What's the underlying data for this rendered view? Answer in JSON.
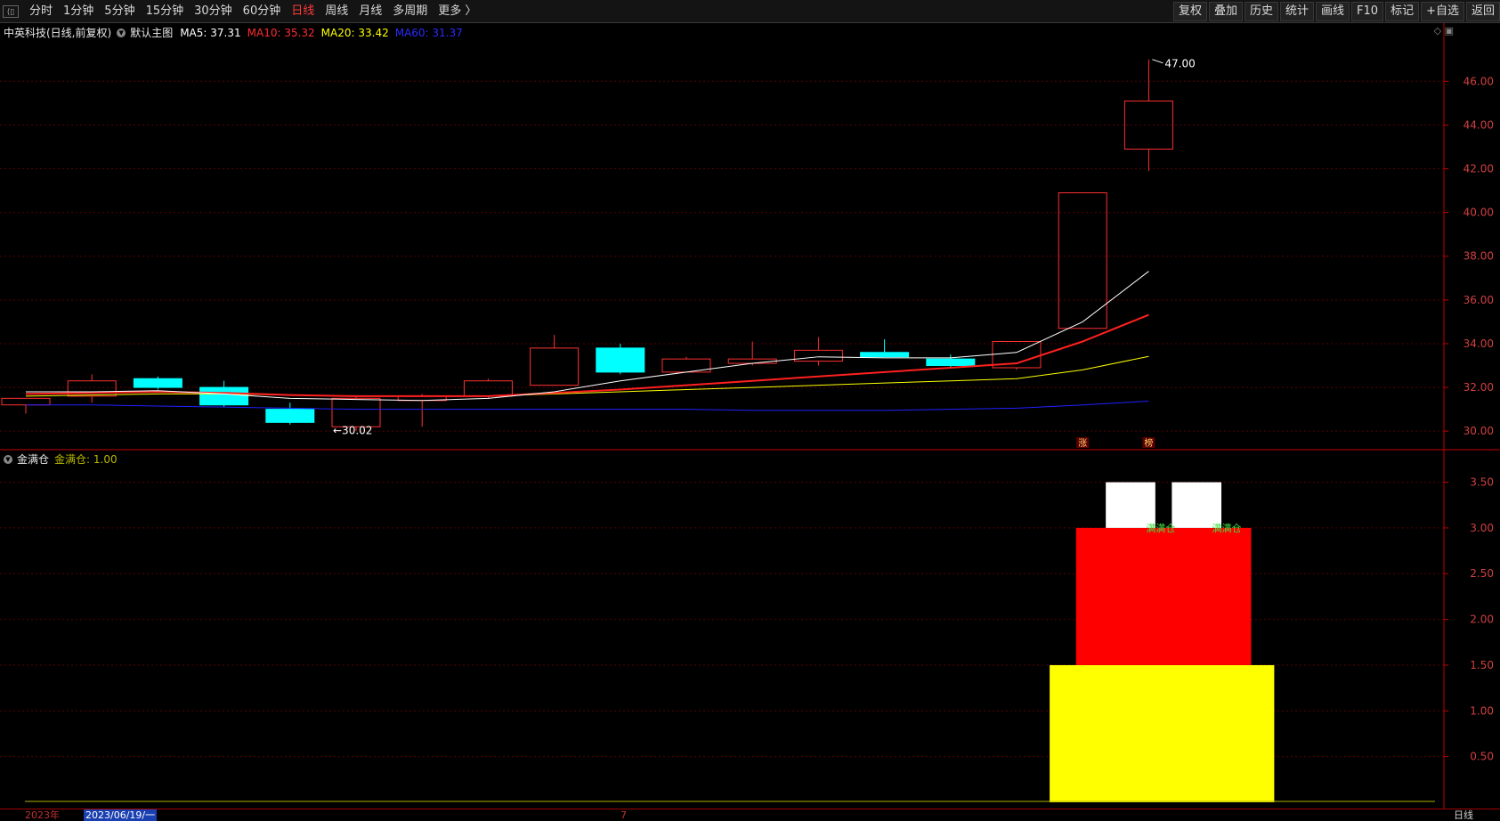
{
  "toolbar": {
    "back_icon": "back-arrow-icon",
    "periods": [
      "分时",
      "1分钟",
      "5分钟",
      "15分钟",
      "30分钟",
      "60分钟",
      "日线",
      "周线",
      "月线",
      "多周期",
      "更多 〉"
    ],
    "active_period": "日线",
    "tools": [
      "复权",
      "叠加",
      "历史",
      "统计",
      "画线",
      "F10",
      "标记",
      "+自选",
      "返回"
    ]
  },
  "main_panel": {
    "stock_title": "中英科技(日线,前复权)",
    "template_label": "默认主图",
    "ma": [
      {
        "label": "MA5: 37.31",
        "color": "#ffffff"
      },
      {
        "label": "MA10: 35.32",
        "color": "#ff2b2b"
      },
      {
        "label": "MA20: 33.42",
        "color": "#ffff00"
      },
      {
        "label": "MA60: 31.37",
        "color": "#2b2bff"
      }
    ],
    "high_marker": "47.00",
    "low_marker": "30.02",
    "badges": [
      "涨",
      "榜"
    ],
    "window_icons": "◇ ▣"
  },
  "sub_panel": {
    "indicator_name": "金满仓",
    "value_label": "金满仓: 1.00",
    "signal_texts": [
      "满满仓",
      "满满仓"
    ]
  },
  "status_bar": {
    "year": "2023年",
    "cursor_date": "2023/06/19/一",
    "month_tick": "7",
    "period": "日线"
  },
  "colors": {
    "up": "#ff3030",
    "down": "#00ffff",
    "ma5": "#ffffff",
    "ma10": "#ff2020",
    "ma20": "#ffff00",
    "ma60": "#2020ff",
    "grid": "#5a0000",
    "axis": "#c00000",
    "bar_yellow": "#ffff00",
    "bar_red": "#ff0000",
    "bar_white": "#ffffff"
  },
  "chart_data": [
    {
      "type": "candlestick",
      "title": "中英科技(日线,前复权)",
      "ylim": [
        29.6,
        47.6
      ],
      "y_ticks": [
        "30.00",
        "32.00",
        "34.00",
        "36.00",
        "38.00",
        "40.00",
        "42.00",
        "44.00",
        "46.00"
      ],
      "candles": [
        {
          "o": 31.2,
          "h": 31.5,
          "l": 30.8,
          "c": 31.5
        },
        {
          "o": 31.6,
          "h": 32.6,
          "l": 31.3,
          "c": 32.3
        },
        {
          "o": 32.4,
          "h": 32.5,
          "l": 31.9,
          "c": 32.0
        },
        {
          "o": 32.0,
          "h": 32.3,
          "l": 31.1,
          "c": 31.2
        },
        {
          "o": 31.0,
          "h": 31.3,
          "l": 30.3,
          "c": 30.4
        },
        {
          "o": 30.2,
          "h": 31.6,
          "l": 30.02,
          "c": 31.5
        },
        {
          "o": 31.4,
          "h": 31.7,
          "l": 30.2,
          "c": 31.6
        },
        {
          "o": 31.6,
          "h": 32.4,
          "l": 31.5,
          "c": 32.3
        },
        {
          "o": 32.1,
          "h": 34.4,
          "l": 32.1,
          "c": 33.8
        },
        {
          "o": 33.8,
          "h": 34.0,
          "l": 32.6,
          "c": 32.7
        },
        {
          "o": 32.7,
          "h": 33.4,
          "l": 32.7,
          "c": 33.3
        },
        {
          "o": 33.1,
          "h": 34.1,
          "l": 33.0,
          "c": 33.3
        },
        {
          "o": 33.2,
          "h": 34.3,
          "l": 33.0,
          "c": 33.7
        },
        {
          "o": 33.6,
          "h": 34.2,
          "l": 33.4,
          "c": 33.4
        },
        {
          "o": 33.3,
          "h": 33.5,
          "l": 32.9,
          "c": 33.0
        },
        {
          "o": 32.9,
          "h": 34.1,
          "l": 32.8,
          "c": 34.1
        },
        {
          "o": 34.7,
          "h": 40.9,
          "l": 34.7,
          "c": 40.9
        },
        {
          "o": 42.9,
          "h": 47.0,
          "l": 41.9,
          "c": 45.1
        }
      ],
      "ma5": [
        31.8,
        31.8,
        31.85,
        31.7,
        31.5,
        31.45,
        31.4,
        31.5,
        31.8,
        32.3,
        32.7,
        33.1,
        33.4,
        33.35,
        33.35,
        33.6,
        35.0,
        37.31
      ],
      "ma10": [
        31.7,
        31.75,
        31.8,
        31.75,
        31.65,
        31.6,
        31.6,
        31.6,
        31.75,
        31.9,
        32.1,
        32.3,
        32.5,
        32.7,
        32.9,
        33.1,
        34.1,
        35.32
      ],
      "ma20": [
        31.6,
        31.65,
        31.7,
        31.7,
        31.65,
        31.6,
        31.6,
        31.6,
        31.7,
        31.8,
        31.9,
        32.0,
        32.1,
        32.2,
        32.3,
        32.4,
        32.8,
        33.42
      ],
      "ma60": [
        31.2,
        31.2,
        31.15,
        31.1,
        31.05,
        31.0,
        31.0,
        31.0,
        31.0,
        31.0,
        31.0,
        30.95,
        30.95,
        30.95,
        31.0,
        31.05,
        31.2,
        31.37
      ]
    },
    {
      "type": "bar",
      "title": "金满仓",
      "ylim": [
        0,
        3.7
      ],
      "y_ticks": [
        "0.50",
        "1.00",
        "1.50",
        "2.00",
        "2.50",
        "3.00",
        "3.50"
      ],
      "series": [
        {
          "name": "yellow",
          "x_from": 15.5,
          "x_to": 18.9,
          "y_from": 0,
          "y_to": 1.5
        },
        {
          "name": "red",
          "x_from": 15.9,
          "x_to": 18.55,
          "y_from": 1.5,
          "y_to": 3.0
        },
        {
          "name": "white",
          "x_from": 16.35,
          "x_to": 17.1,
          "y_from": 3.0,
          "y_to": 3.5
        },
        {
          "name": "white",
          "x_from": 17.35,
          "x_to": 18.1,
          "y_from": 3.0,
          "y_to": 3.5
        }
      ],
      "baseline": 0.01
    }
  ]
}
